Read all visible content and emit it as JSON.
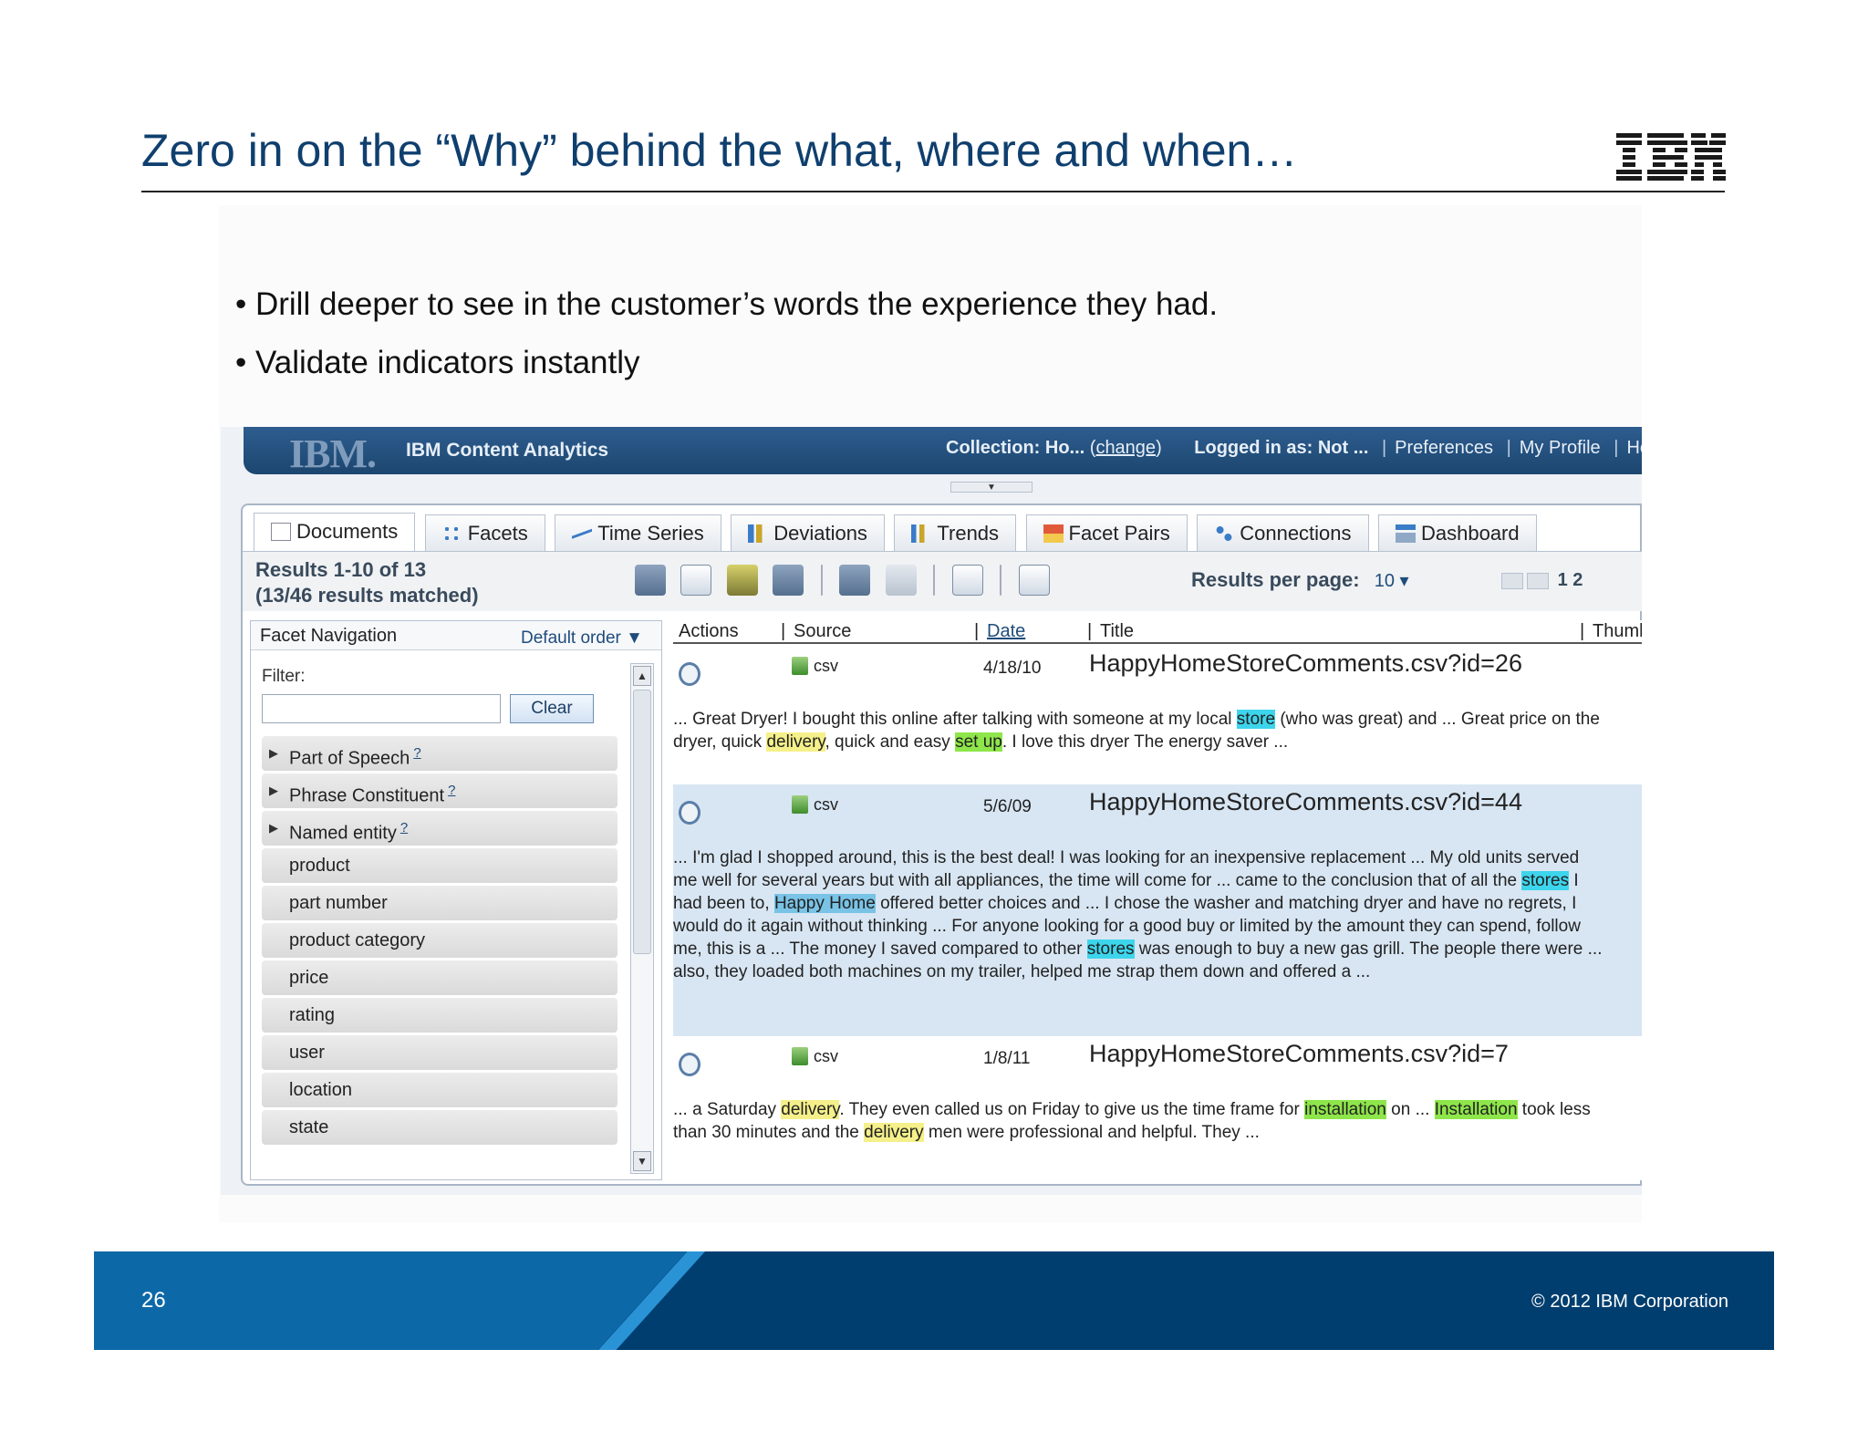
{
  "slide": {
    "title": "Zero in on the “Why” behind the what, where and when…",
    "logo": "IBM",
    "bullets": [
      "• Drill deeper to see in the customer’s words the experience they had.",
      "• Validate indicators instantly"
    ],
    "page_number": "26",
    "copyright": "© 2012 IBM Corporation"
  },
  "app": {
    "logo": "IBM.",
    "name": "IBM Content Analytics",
    "collection_label": "Collection: Ho...",
    "collection_change": "change",
    "logged_in": "Logged in as: Not ...",
    "links": [
      "Preferences",
      "My Profile",
      "He"
    ],
    "tabs": [
      "Documents",
      "Facets",
      "Time Series",
      "Deviations",
      "Trends",
      "Facet Pairs",
      "Connections",
      "Dashboard"
    ],
    "results_line1": "Results 1-10 of 13",
    "results_line2": "(13/46 results matched)",
    "results_per_page_label": "Results per page:",
    "results_per_page_value": "10",
    "pager": "1 2",
    "facet_nav": {
      "title": "Facet Navigation",
      "order": "Default order",
      "filter_label": "Filter:",
      "clear": "Clear",
      "items": [
        "Part of Speech",
        "Phrase Constituent",
        "Named entity",
        "product",
        "part number",
        "product category",
        "price",
        "rating",
        "user",
        "location",
        "state"
      ],
      "help_mark": "?"
    },
    "columns": [
      "Actions",
      "Source",
      "Date",
      "Title",
      "Thumbna"
    ],
    "icons": [
      "refresh-icon",
      "view-icon",
      "save-icon",
      "export-icon",
      "back-icon",
      "forward-icon",
      "add-icon",
      "layout-icon"
    ]
  },
  "docs": [
    {
      "source": "csv",
      "date": "4/18/10",
      "title": "HappyHomeStoreComments.csv?id=26"
    },
    {
      "source": "csv",
      "date": "5/6/09",
      "title": "HappyHomeStoreComments.csv?id=44"
    },
    {
      "source": "csv",
      "date": "1/8/11",
      "title": "HappyHomeStoreComments.csv?id=7"
    }
  ],
  "snippets": {
    "d1": {
      "a": "... Great Dryer! I bought this online after talking with someone at my local ",
      "b": "store",
      "c": " (who was great) and ... Great price on the dryer, quick ",
      "d": "delivery",
      "e": ", quick and easy ",
      "f": "set up",
      "g": ". I love this dryer The energy saver ..."
    },
    "d2": {
      "a": "... I'm glad I shopped around, this is the best deal! I was looking for an inexpensive replacement ... My old units served me well for several years but with all appliances, the time will come for ... came to the conclusion that of all the ",
      "b": "stores",
      "c": " I had been to, ",
      "d": "Happy Home",
      "e": " offered better choices and ... I chose the washer and matching dryer and have no regrets, I would do it again without thinking ... For anyone looking for a good buy or limited by the amount they can spend, follow me, this is a ... The money I saved compared to other ",
      "f": "stores",
      "g": " was enough to buy a new gas grill. The people there were ... also, they loaded both machines on my trailer, helped me strap them down and offered a ..."
    },
    "d3": {
      "a": "... a Saturday ",
      "b": "delivery",
      "c": ". They even called us on Friday to give us the time frame for ",
      "d": "installation",
      "e": " on ... ",
      "f": "Installation",
      "g": " took less than 30 minutes and the ",
      "h": "delivery",
      "i": " men were professional and helpful. They ..."
    }
  },
  "colors": {
    "title": "#0f3f6e",
    "footer": "#003e6f",
    "highlight_cyan": "#3dd5ec",
    "highlight_yellow": "#f5f08a",
    "highlight_green": "#8ee64a",
    "row_alt": "#d8e6f3"
  }
}
